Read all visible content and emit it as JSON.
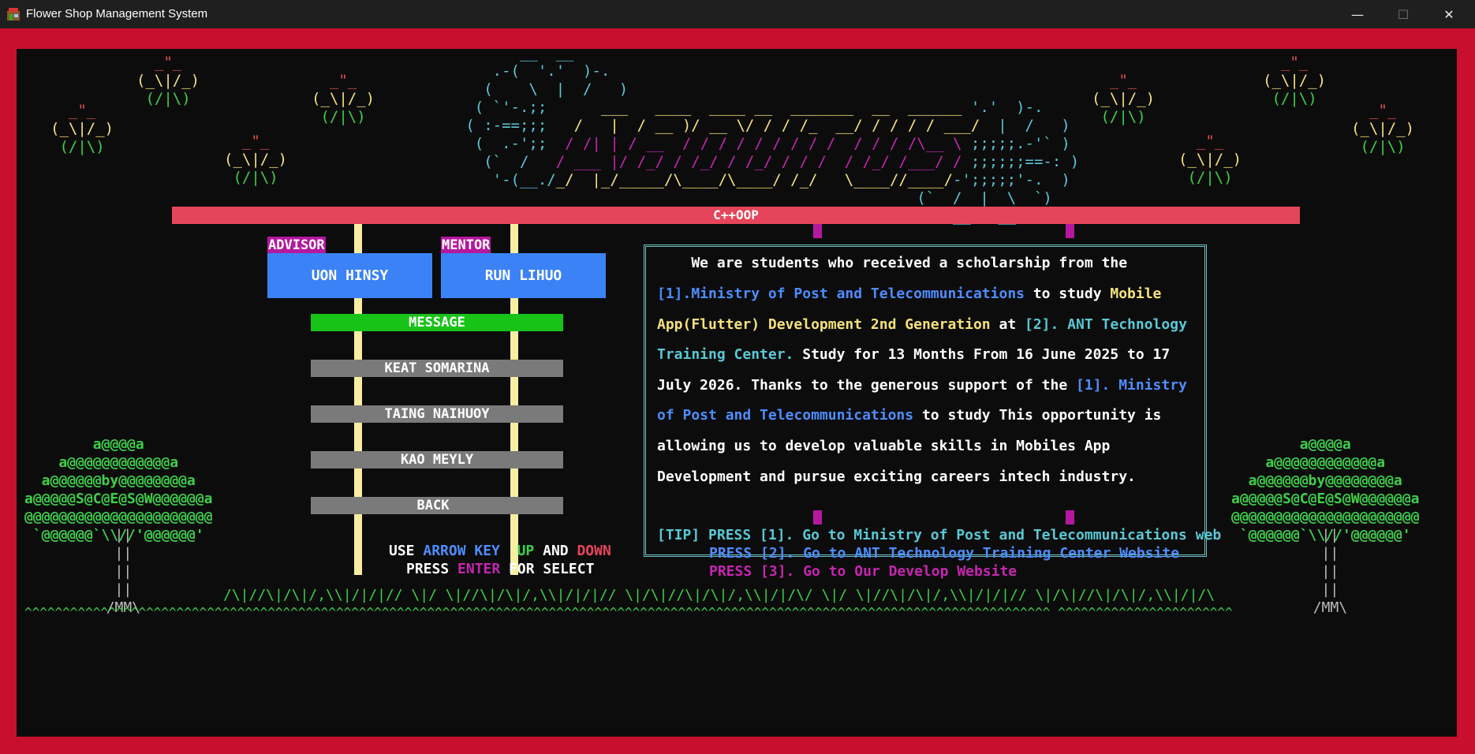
{
  "window": {
    "title": "Flower Shop Management System",
    "controls": {
      "minimize": "—",
      "maximize": "☐",
      "close": "✕"
    }
  },
  "banner": {
    "bar_label": "C++OOP"
  },
  "staff": {
    "advisor_tag": "ADVISOR",
    "advisor_name": "UON HINSY",
    "mentor_tag": "MENTOR",
    "mentor_name": "RUN LIHUO"
  },
  "menu": {
    "items": [
      {
        "label": "MESSAGE",
        "selected": true
      },
      {
        "label": "KEAT SOMARINA",
        "selected": false
      },
      {
        "label": "TAING NAIHUOY",
        "selected": false
      },
      {
        "label": "KAO MEYLY",
        "selected": false
      },
      {
        "label": "BACK",
        "selected": false
      }
    ]
  },
  "message": {
    "l1": "    We are students who received a scholarship from the",
    "l2_a": "[1].Ministry of Post and Telecommunications",
    "l2_b": " to study ",
    "l2_c": "Mobile",
    "l3_a": "App(Flutter) Development 2nd Generation",
    "l3_b": " at ",
    "l3_c": "[2]. ANT Technology",
    "l4_a": "Training Center.",
    "l4_b": " Study for 13 Months From 16 June 2025 to 17",
    "l5_a": "July 2026. Thanks to the generous support of the ",
    "l5_b": "[1]. Ministry",
    "l6_a": "of Post and Telecommunications",
    "l6_b": " to study This opportunity is",
    "l7": "allowing us to develop valuable skills in Mobiles App",
    "l8": "Development and pursue exciting careers intech industry."
  },
  "hints": {
    "use": "USE ",
    "arrow_key": "ARROW KEY",
    "up": "UP",
    "and": " AND ",
    "down": "DOWN",
    "press": "PRESS ",
    "enter": "ENTER",
    "for_select": " FOR SELECT"
  },
  "tips": {
    "t1": "[TIP] PRESS [1]. Go to Ministry of Post and Telecommunications web",
    "t2": "PRESS [2]. Go to ANT Technology Training Center Website",
    "t3": "PRESS [3]. Go to Our Develop Website"
  },
  "art": {
    "flower": " _\"_\n(_\\|/_)\n (/|\\)",
    "logo_top": "         __  __\n      .-(  '.'  )-.\n     (    \\  |  /   )\n    ( `'-.;;\n   ( :-==;;;\n    (  .-';;\n     (`  /\n      '-(__./_/",
    "tree": "        a@@@@a\n    a@@@@@@@@@@@@a\n  a@@@@@@by@@@@@@@@a\na@@@@@S@C@E@S@W@@@@@@a\n@@@@@@@@@@@@@@@@@@@@@@\n `@@@@@@`\\\\//'@@@@@@'",
    "trunk": "         ||\n         ||\n         ||\n         ||\n        /MM\\",
    "grass_mid": "/\\|//\\|/\\|/,\\\\|/|/|// \\|/ \\|//\\|/\\|/,\\\\|/|/|// \\|/\\|//\\|/\\|/,\\\\|/|/\\/ \\|/ \\|//\\|/\\|/,\\\\|/|/|// \\|/\\|//\\|/\\|/,\\\\|/|/\\",
    "grass_base": "^^^^^^^^^^^^^^^^^^^^^^^^^^^^^^^^^^^^^^^^^^^^^^^^^^^^^^^^^^^^^^^^^^^^^^^^^^^^^^^^^^^^^^^^^^^^^^^^^^^^^^^^^^^^^^^^^^^^^^^^^^^^^^^^^^^^^^^ ^^^^^^^^^^^^^^^^^^^^^^^"
  }
}
